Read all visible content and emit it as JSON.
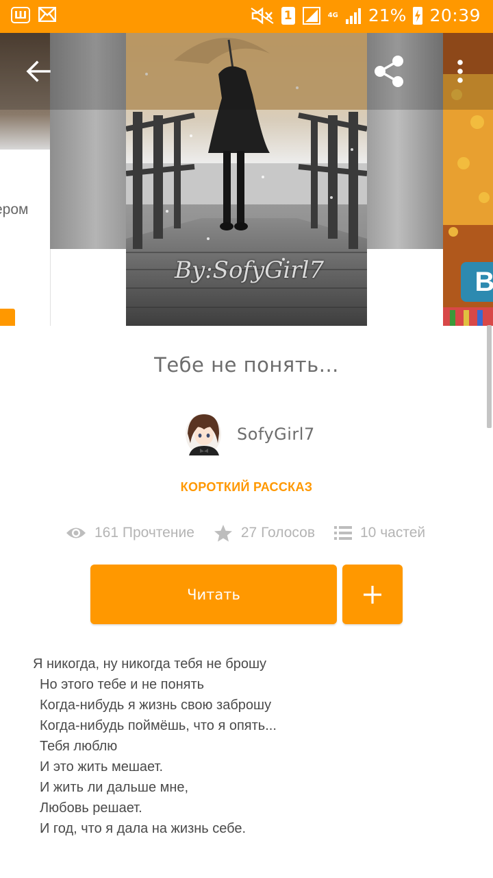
{
  "status_bar": {
    "app_icon_text": "Ш",
    "sim_slot": "1",
    "network": "4G",
    "battery_percent": "21%",
    "time": "20:39"
  },
  "carousel": {
    "prev_cover_text": "ером",
    "main_cover_signature": "By:SofyGirl7",
    "next_cover_letter": "B"
  },
  "story": {
    "title": "Тебе не понять...",
    "author": "SofyGirl7",
    "category": "КОРОТКИЙ РАССКАЗ",
    "stats": {
      "reads": "161 Прочтение",
      "votes": "27 Голосов",
      "parts": "10 частей"
    },
    "read_button_label": "Читать",
    "description_lines": [
      "Я никогда, ну никогда тебя не брошу",
      "Но этого тебе и не понять",
      "Когда-нибудь я жизнь свою заброшу",
      "Когда-нибудь поймёшь, что я опять...",
      "Тебя люблю",
      "И это жить мешает.",
      "И жить ли дальше мне,",
      "Любовь решает.",
      "И год, что я дала на жизнь себе."
    ]
  },
  "icons": {
    "back": "arrow-left-icon",
    "share": "share-icon",
    "more": "more-vert-icon",
    "reads": "eye-icon",
    "votes": "star-icon",
    "parts": "list-icon",
    "add": "plus-icon"
  },
  "colors": {
    "accent": "#ff9800",
    "stat_text": "#b4b4b4",
    "title_text": "#6d6d6d",
    "body_text": "#4a4a4a"
  }
}
